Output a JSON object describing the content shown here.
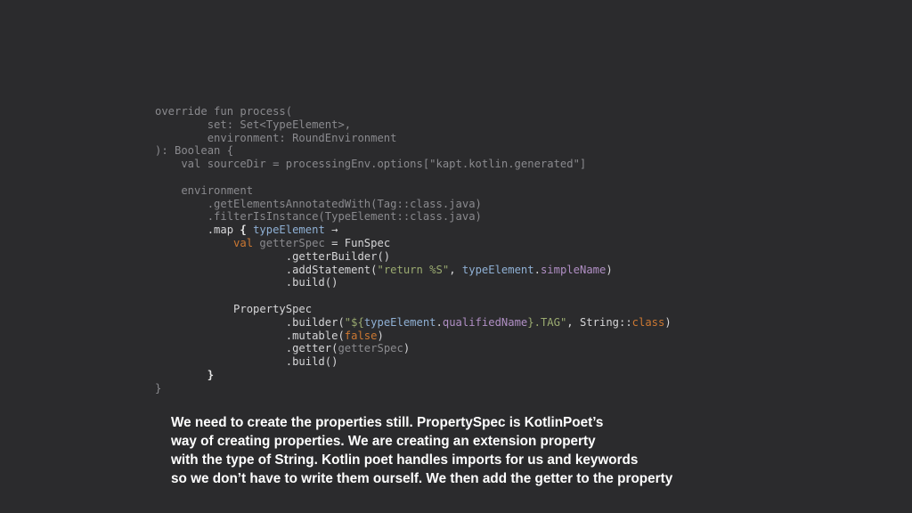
{
  "code": {
    "lines": [
      {
        "style": "dim",
        "segments": [
          {
            "t": "override fun process(",
            "c": "dim"
          }
        ]
      },
      {
        "style": "dim",
        "segments": [
          {
            "t": "        set: Set<TypeElement>,",
            "c": "dim"
          }
        ]
      },
      {
        "style": "dim",
        "segments": [
          {
            "t": "        environment: RoundEnvironment",
            "c": "dim"
          }
        ]
      },
      {
        "style": "dim",
        "segments": [
          {
            "t": "): Boolean {",
            "c": "dim"
          }
        ]
      },
      {
        "style": "dim",
        "segments": [
          {
            "t": "    val sourceDir = processingEnv.options[\"kapt.kotlin.generated\"]",
            "c": "dim"
          }
        ]
      },
      {
        "style": "dim",
        "segments": [
          {
            "t": "",
            "c": "dim"
          }
        ]
      },
      {
        "style": "dim",
        "segments": [
          {
            "t": "    environment",
            "c": "dim"
          }
        ]
      },
      {
        "style": "dim",
        "segments": [
          {
            "t": "        .getElementsAnnotatedWith(Tag::class.java)",
            "c": "dim"
          }
        ]
      },
      {
        "style": "dim",
        "segments": [
          {
            "t": "        .filterIsInstance(TypeElement::class.java)",
            "c": "dim"
          }
        ]
      },
      {
        "style": "bright",
        "segments": [
          {
            "t": "        .map ",
            "c": "text"
          },
          {
            "t": "{",
            "c": "brace"
          },
          {
            "t": " typeElement ",
            "c": "param"
          },
          {
            "t": "→",
            "c": "text"
          }
        ]
      },
      {
        "style": "bright",
        "segments": [
          {
            "t": "            val ",
            "c": "kw"
          },
          {
            "t": "getterSpec",
            "c": "dim"
          },
          {
            "t": " = FunSpec",
            "c": "text"
          }
        ]
      },
      {
        "style": "bright",
        "segments": [
          {
            "t": "                    .getterBuilder()",
            "c": "text"
          }
        ]
      },
      {
        "style": "bright",
        "segments": [
          {
            "t": "                    .addStatement(",
            "c": "text"
          },
          {
            "t": "\"return %S\"",
            "c": "str"
          },
          {
            "t": ", ",
            "c": "text"
          },
          {
            "t": "typeElement",
            "c": "param"
          },
          {
            "t": ".",
            "c": "text"
          },
          {
            "t": "simpleName",
            "c": "prop"
          },
          {
            "t": ")",
            "c": "text"
          }
        ]
      },
      {
        "style": "bright",
        "segments": [
          {
            "t": "                    .build()",
            "c": "text"
          }
        ]
      },
      {
        "style": "bright",
        "segments": [
          {
            "t": "",
            "c": "text"
          }
        ]
      },
      {
        "style": "bright",
        "segments": [
          {
            "t": "            PropertySpec",
            "c": "text"
          }
        ]
      },
      {
        "style": "bright",
        "segments": [
          {
            "t": "                    .builder(",
            "c": "text"
          },
          {
            "t": "\"${",
            "c": "str"
          },
          {
            "t": "typeElement",
            "c": "param"
          },
          {
            "t": ".",
            "c": "text"
          },
          {
            "t": "qualifiedName",
            "c": "prop"
          },
          {
            "t": "}.TAG\"",
            "c": "str"
          },
          {
            "t": ", String::",
            "c": "text"
          },
          {
            "t": "class",
            "c": "kw"
          },
          {
            "t": ")",
            "c": "text"
          }
        ]
      },
      {
        "style": "bright",
        "segments": [
          {
            "t": "                    .mutable(",
            "c": "text"
          },
          {
            "t": "false",
            "c": "kw"
          },
          {
            "t": ")",
            "c": "text"
          }
        ]
      },
      {
        "style": "bright",
        "segments": [
          {
            "t": "                    .getter(",
            "c": "text"
          },
          {
            "t": "getterSpec",
            "c": "dim"
          },
          {
            "t": ")",
            "c": "text"
          }
        ]
      },
      {
        "style": "bright",
        "segments": [
          {
            "t": "                    .build()",
            "c": "text"
          }
        ]
      },
      {
        "style": "bright",
        "segments": [
          {
            "t": "        ",
            "c": "text"
          },
          {
            "t": "}",
            "c": "brace"
          }
        ]
      },
      {
        "style": "dim",
        "segments": [
          {
            "t": "}",
            "c": "dim"
          }
        ]
      }
    ]
  },
  "caption": {
    "lines": [
      "We need to create the properties still. PropertySpec is KotlinPoet’s",
      "way of creating properties. We are creating an extension property",
      "with the type of String. Kotlin poet handles imports for us and keywords",
      "so we don’t have to write them ourself. We then add the getter to the property"
    ]
  }
}
